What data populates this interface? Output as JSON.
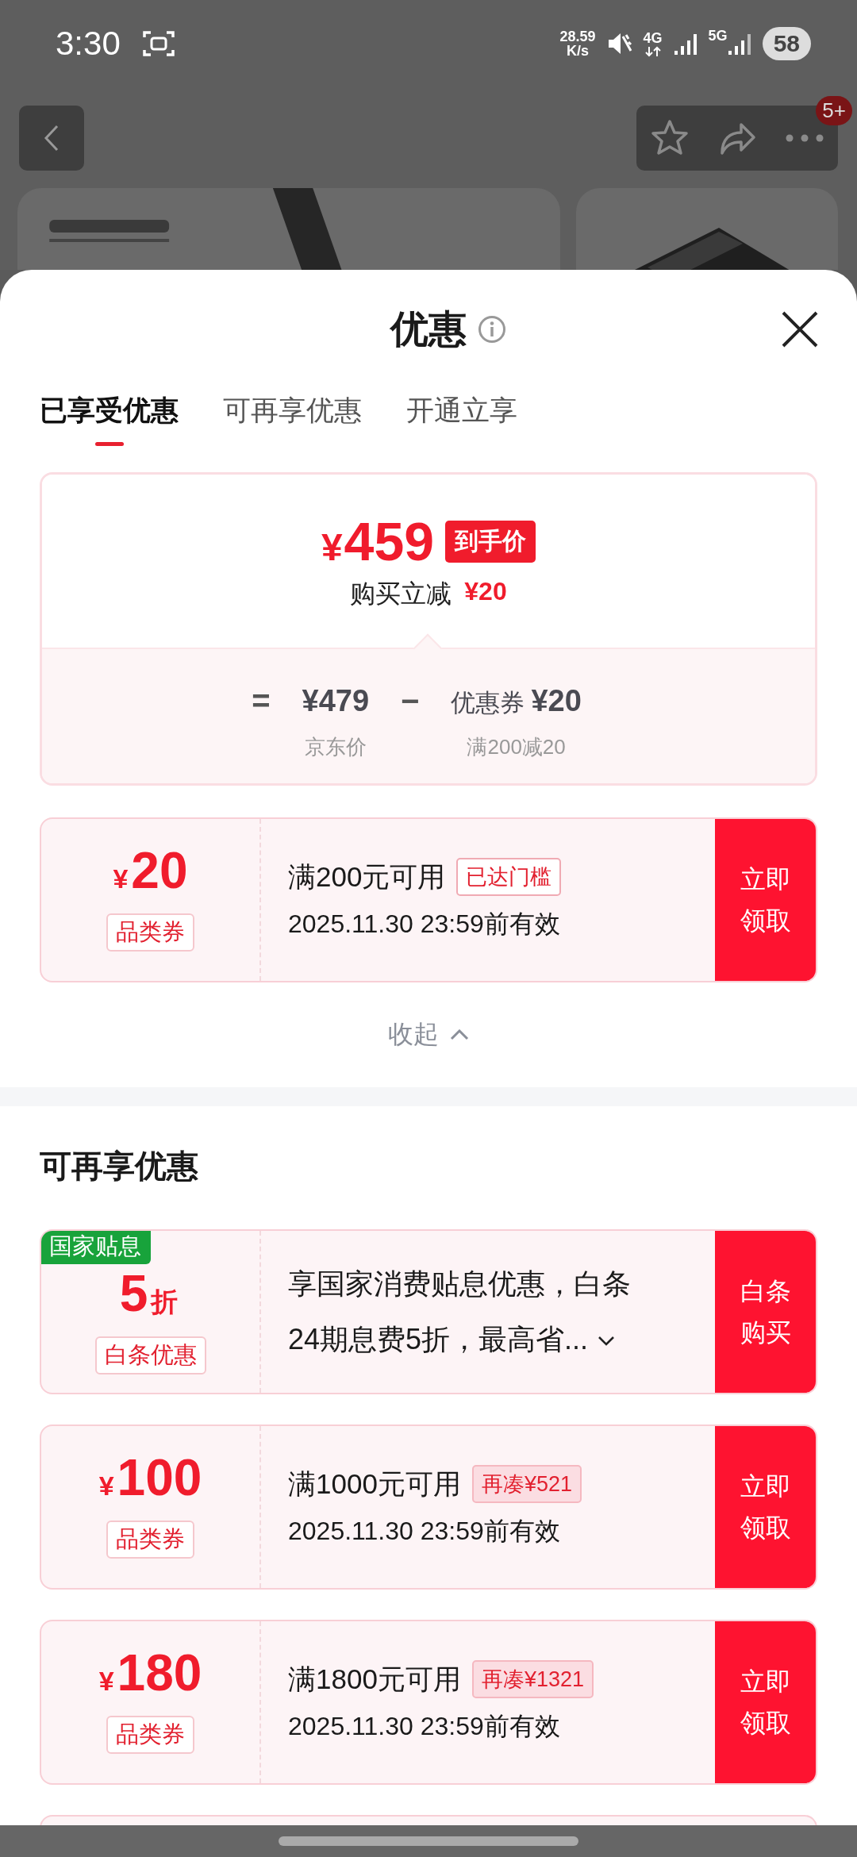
{
  "status_bar": {
    "time": "3:30",
    "net_speed": "28.59",
    "net_unit": "K/s",
    "network_1": "4G",
    "network_2": "5G",
    "battery": "58"
  },
  "nav": {
    "more_badge": "5+"
  },
  "sheet": {
    "title": "优惠",
    "tabs": [
      {
        "label": "已享受优惠",
        "selected": true
      },
      {
        "label": "可再享优惠",
        "selected": false
      },
      {
        "label": "开通立享",
        "selected": false
      }
    ],
    "summary": {
      "currency": "¥",
      "price": "459",
      "price_tag": "到手价",
      "saving_label": "购买立减",
      "saving_amount": "¥20",
      "equals": "=",
      "original_price": "¥479",
      "minus": "−",
      "coupon_label": "优惠券",
      "coupon_amount": "¥20",
      "original_price_caption": "京东价",
      "coupon_caption": "满200减20"
    },
    "applied_coupons": [
      {
        "kind": "coupon",
        "currency": "¥",
        "amount": "20",
        "tag": "品类券",
        "condition": "满200元可用",
        "badge": "已达门槛",
        "threshold_met": true,
        "validity": "2025.11.30 23:59前有效",
        "action": "立即领取"
      }
    ],
    "collapse": "收起",
    "more_section": {
      "title": "可再享优惠",
      "offers": [
        {
          "kind": "discount",
          "corner_label": "国家贴息",
          "amount": "5",
          "unit": "折",
          "tag": "白条优惠",
          "lines": [
            "享国家消费贴息优惠，白条",
            "24期息费5折，最高省..."
          ],
          "action": "白条购买"
        },
        {
          "kind": "coupon",
          "currency": "¥",
          "amount": "100",
          "tag": "品类券",
          "condition": "满1000元可用",
          "badge": "再凑¥521",
          "threshold_met": false,
          "validity": "2025.11.30 23:59前有效",
          "action": "立即领取"
        },
        {
          "kind": "coupon",
          "currency": "¥",
          "amount": "180",
          "tag": "品类券",
          "condition": "满1800元可用",
          "badge": "再凑¥1321",
          "threshold_met": false,
          "validity": "2025.11.30 23:59前有效",
          "action": "立即领取"
        }
      ]
    }
  }
}
